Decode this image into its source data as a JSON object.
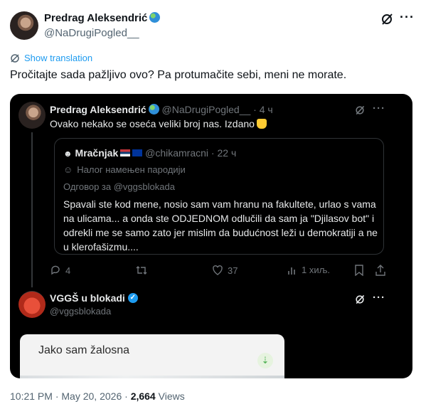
{
  "tweet": {
    "author_name": "Predrag Aleksendrić",
    "author_handle": "@NaDrugiPogled__",
    "show_translation": "Show translation",
    "text": "Pročitajte sada pažljivo ovo? Pa protumačite sebi, meni ne morate.",
    "time": "10:21 PM",
    "date": "May 20, 2026",
    "views_count": "2,664",
    "views_label": "Views",
    "separator": "·"
  },
  "screenshot": {
    "post1": {
      "name": "Predrag Aleksendrić",
      "handle": "@NaDrugiPogled__",
      "time": "4 ч",
      "dot": "·",
      "text": "Ovako nekako se oseća veliki broj nas. Izdano"
    },
    "quote": {
      "name": "Mračnjak",
      "handle": "@chikamracni",
      "time": "22 ч",
      "dot": "·",
      "parody_label": "Налог намењен пародији",
      "reply_to": "Одговор за @vggsblokada",
      "body_lines": [
        "Spavali ste kod mene, nosio sam vam hranu na fakultete, urlao s vama",
        "na ulicama... a onda ste ODJEDNOM odlučili da sam ja \"Djilasov bot\" i",
        "odrekli me se samo zato jer mislim da budućnost leži u demokratiji a ne",
        "u klerofašizmu...."
      ]
    },
    "actions": {
      "replies": "4",
      "likes": "37",
      "views": "1 хиљ."
    },
    "post2": {
      "name": "VGGŠ u blokadi",
      "handle": "@vggsblokada",
      "embed_title": "Jako sam žalosna"
    }
  },
  "colors": {
    "accent": "#1d9bf0",
    "dark_bg": "#000000",
    "muted": "#536471"
  }
}
